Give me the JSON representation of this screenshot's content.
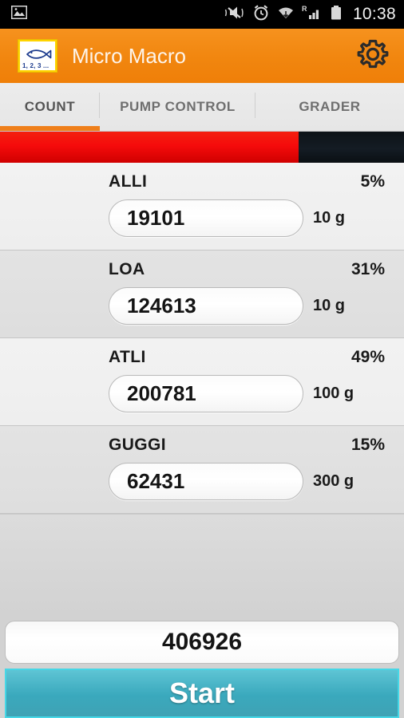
{
  "status_bar": {
    "left_icons": [
      "image-icon"
    ],
    "right_icons": [
      "mute-vibrate-icon",
      "alarm-icon",
      "wifi-icon",
      "roaming-signal-icon",
      "battery-icon"
    ],
    "time": "10:38"
  },
  "app_bar": {
    "logo_caption": "1, 2, 3 ...",
    "logo_icon": "fish-icon",
    "title": "Micro Macro",
    "settings_icon": "gear-icon"
  },
  "tabs": [
    {
      "label": "COUNT",
      "active": true
    },
    {
      "label": "PUMP CONTROL",
      "active": false
    },
    {
      "label": "GRADER",
      "active": false
    }
  ],
  "progress": {
    "percent": 74,
    "fill_color": "#f50b0b",
    "track_color": "#111820"
  },
  "rows": [
    {
      "name": "ALLI",
      "percent": "5%",
      "count": "19101",
      "weight": "10 g"
    },
    {
      "name": "LOA",
      "percent": "31%",
      "count": "124613",
      "weight": "10 g"
    },
    {
      "name": "ATLI",
      "percent": "49%",
      "count": "200781",
      "weight": "100 g"
    },
    {
      "name": "GUGGI",
      "percent": "15%",
      "count": "62431",
      "weight": "300 g"
    }
  ],
  "footer": {
    "total": "406926",
    "start_label": "Start",
    "accent_color": "#3aa9bd"
  }
}
